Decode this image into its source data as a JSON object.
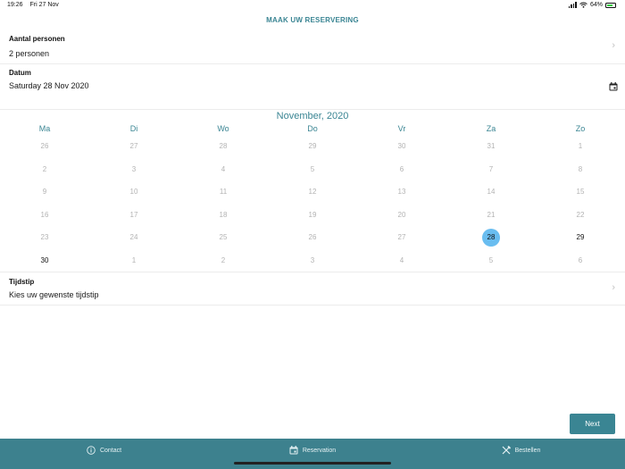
{
  "status_bar": {
    "time": "19:26",
    "date": "Fri 27 Nov",
    "battery": "64%"
  },
  "page_title": "MAAK UW RESERVERING",
  "persons": {
    "label": "Aantal personen",
    "value": "2 personen"
  },
  "date_field": {
    "label": "Datum",
    "value": "Saturday 28 Nov 2020"
  },
  "calendar": {
    "month_title": "November, 2020",
    "weekdays": [
      "Ma",
      "Di",
      "Wo",
      "Do",
      "Vr",
      "Za",
      "Zo"
    ],
    "weeks": [
      [
        "26",
        "27",
        "28",
        "29",
        "30",
        "31",
        "1"
      ],
      [
        "2",
        "3",
        "4",
        "5",
        "6",
        "7",
        "8"
      ],
      [
        "9",
        "10",
        "11",
        "12",
        "13",
        "14",
        "15"
      ],
      [
        "16",
        "17",
        "18",
        "19",
        "20",
        "21",
        "22"
      ],
      [
        "23",
        "24",
        "25",
        "26",
        "27",
        "28",
        "29"
      ],
      [
        "30",
        "1",
        "2",
        "3",
        "4",
        "5",
        "6"
      ]
    ]
  },
  "time_field": {
    "label": "Tijdstip",
    "placeholder": "Kies uw gewenste tijdstip"
  },
  "next_button": "Next",
  "tabs": {
    "contact": "Contact",
    "reservation": "Reservation",
    "order": "Bestellen"
  },
  "colors": {
    "accent": "#3a8593",
    "tab_bar": "#3d818e",
    "selected_day": "#69bdf0"
  }
}
